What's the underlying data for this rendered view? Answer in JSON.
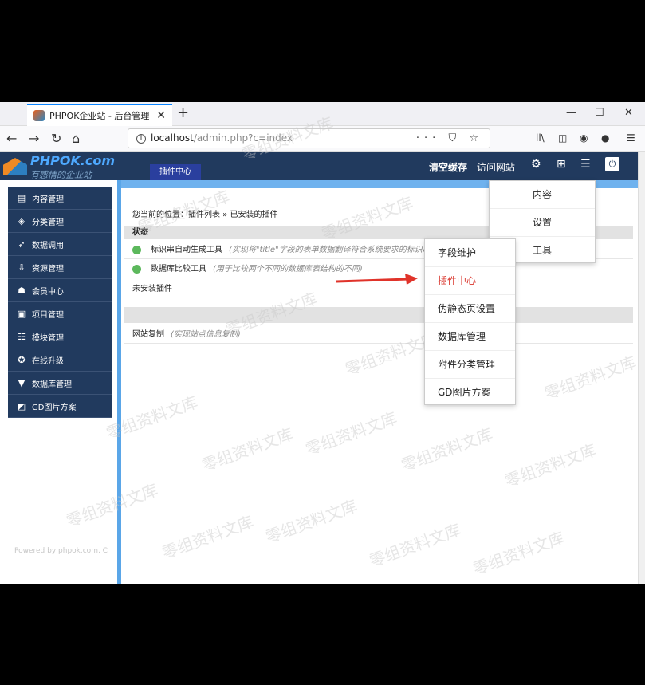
{
  "browser": {
    "tab_title": "PHPOK企业站 - 后台管理",
    "tab_close": "✕",
    "new_tab": "+",
    "win_min": "—",
    "win_max": "☐",
    "win_close": "✕",
    "nav_back": "←",
    "nav_forward": "→",
    "nav_reload": "↻",
    "nav_home": "⌂",
    "url_info": "i",
    "url_host": "localhost",
    "url_path": "/admin.php?c=index",
    "url_actions": "··· ⛉ ☆",
    "tool_library": "ll\\",
    "tool_sidebar": "◫",
    "tool_account": "◉",
    "tool_ext": "●",
    "tool_menu": "☰"
  },
  "header": {
    "logo_name": "PHPOK.com",
    "logo_slogan": "有感情的企业站",
    "active_tab": "插件中心",
    "clear_cache": "清空缓存",
    "visit_site": "访问网站",
    "icon_gear": "⚙",
    "icon_windows": "⊞",
    "icon_list": "☰",
    "icon_power": "⏻"
  },
  "sidebar": {
    "items": [
      {
        "icon": "▤",
        "label": "内容管理"
      },
      {
        "icon": "◈",
        "label": "分类管理"
      },
      {
        "icon": "➶",
        "label": "数据调用"
      },
      {
        "icon": "⇩",
        "label": "资源管理"
      },
      {
        "icon": "☗",
        "label": "会员中心"
      },
      {
        "icon": "▣",
        "label": "项目管理"
      },
      {
        "icon": "☷",
        "label": "模块管理"
      },
      {
        "icon": "✪",
        "label": "在线升级"
      },
      {
        "icon": "▼",
        "label": "数据库管理"
      },
      {
        "icon": "◩",
        "label": "GD图片方案"
      }
    ],
    "footer": "Powered by phpok.com, C"
  },
  "main": {
    "breadcrumb": "您当前的位置：插件列表 » 已安装的插件",
    "status_header": "状态",
    "installed": [
      {
        "name": "标识串自动生成工具",
        "desc": "(实现将\"title\"字段的表单数据翻译符合系统要求的标识串"
      },
      {
        "name": "数据库比较工具",
        "desc": "(用于比较两个不同的数据库表结构的不同)"
      }
    ],
    "uninstalled_header": "未安装插件",
    "uninstalled": [
      {
        "name": "网站复制",
        "desc": "(实现站点信息复制)"
      }
    ]
  },
  "dropdown_top": {
    "items": [
      "内容",
      "设置",
      "工具"
    ]
  },
  "dropdown_tools": {
    "items": [
      "字段维护",
      "插件中心",
      "伪静态页设置",
      "数据库管理",
      "附件分类管理",
      "GD图片方案"
    ],
    "active_index": 1
  },
  "watermark": "零组资料文库",
  "colors": {
    "header_bg": "#213a5e",
    "accent_blue": "#6fb2ee",
    "active_red": "#d9342b",
    "arrow_red": "#e0332a"
  }
}
